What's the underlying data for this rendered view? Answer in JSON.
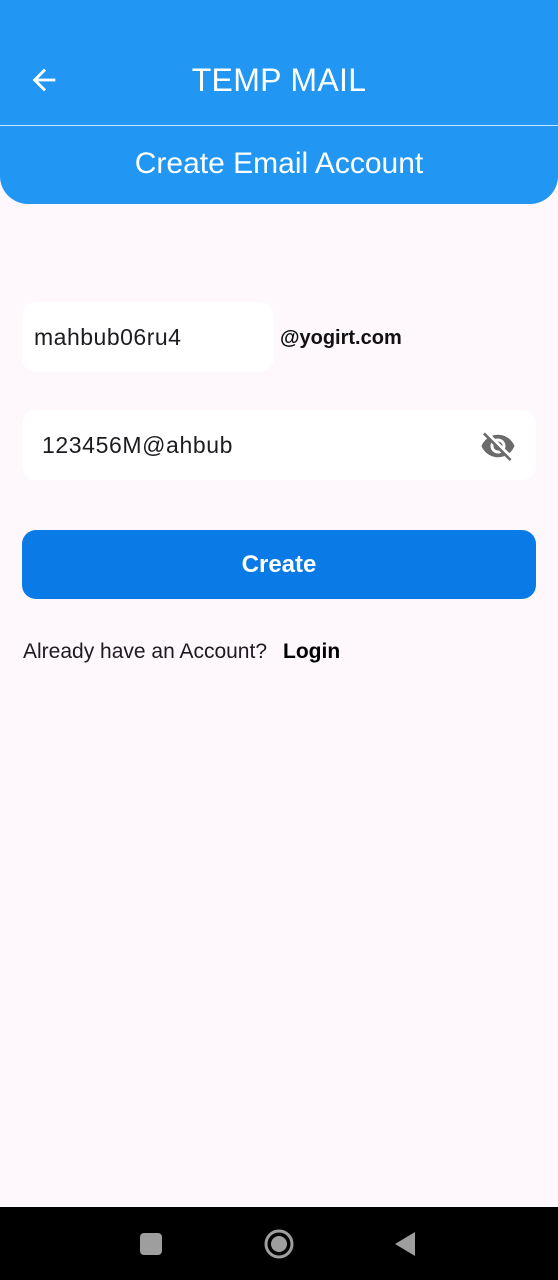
{
  "app_bar": {
    "title": "TEMP MAIL",
    "subtitle": "Create Email Account",
    "back_icon": "arrow-back-icon",
    "background": "#2196F3"
  },
  "form": {
    "username_value": "mahbub06ru4",
    "domain": "@yogirt.com",
    "password_value": "123456M@ahbub",
    "visibility_icon": "eye-off-icon",
    "create_label": "Create",
    "create_color": "#0A7AE6"
  },
  "login_prompt": {
    "text": "Already have an Account?",
    "link": "Login"
  },
  "system_nav": {
    "recents_icon": "square-icon",
    "home_icon": "circle-home-icon",
    "back_icon": "triangle-back-icon"
  }
}
